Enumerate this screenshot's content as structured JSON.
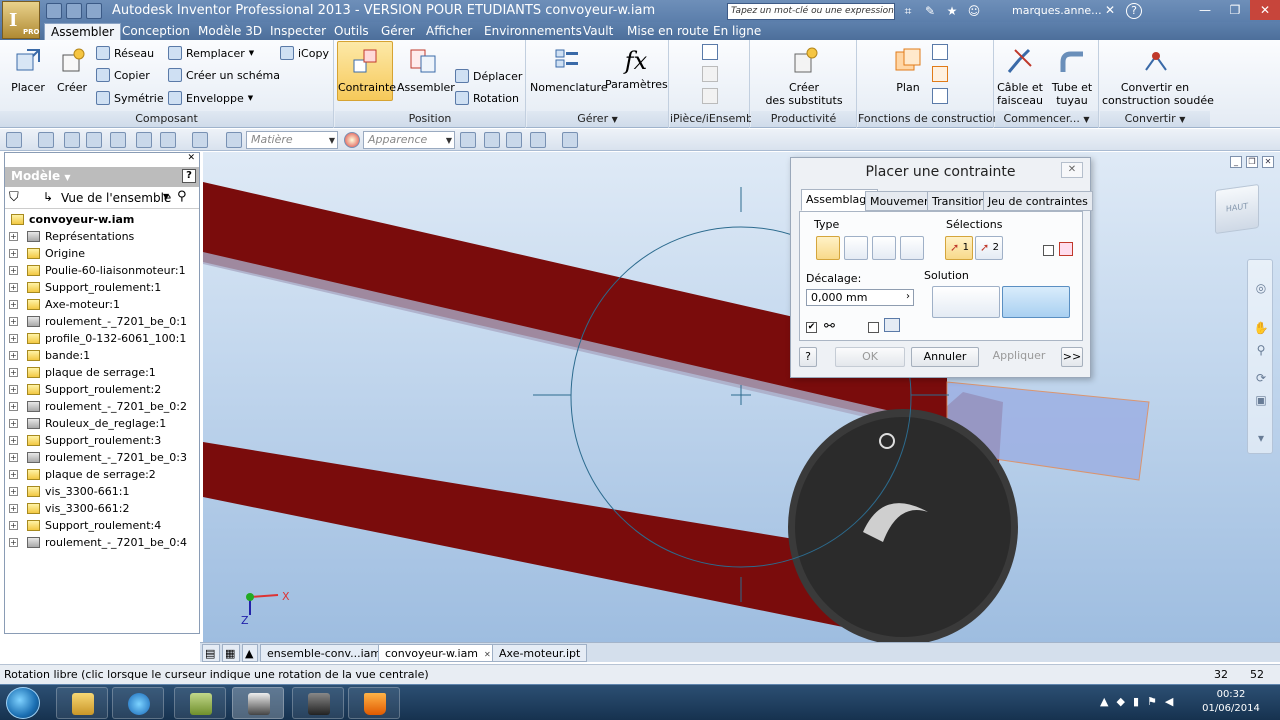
{
  "app": {
    "logo_letter": "I",
    "logo_sub": "PRO",
    "window_title": "Autodesk Inventor Professional 2013 - VERSION POUR ETUDIANTS    convoyeur-w.iam",
    "search_placeholder": "Tapez un mot-clé ou une expression",
    "user": "marques.anne...",
    "help_icon": "?"
  },
  "menu_tabs": [
    "Assembler",
    "Conception",
    "Modèle 3D",
    "Inspecter",
    "Outils",
    "Gérer",
    "Afficher",
    "Environnements",
    "Vault",
    "Mise en route",
    "En ligne"
  ],
  "ribbon": {
    "composant": {
      "title": "Composant",
      "placer": "Placer",
      "creer": "Créer",
      "reseau": "Réseau",
      "copier": "Copier",
      "symetrie": "Symétrie",
      "remplacer": "Remplacer",
      "creer_schema": "Créer un schéma",
      "enveloppe": "Enveloppe",
      "icopy": "iCopy"
    },
    "position": {
      "title": "Position",
      "contrainte": "Contrainte",
      "assembler": "Assembler",
      "deplacer": "Déplacer",
      "rotation": "Rotation"
    },
    "gerer": {
      "title": "Gérer",
      "nomenclature": "Nomenclature",
      "parametres": "Paramètres"
    },
    "ipiece": {
      "title": "iPièce/iEnsemble"
    },
    "productivite": {
      "title": "Productivité",
      "creer_substituts_1": "Créer",
      "creer_substituts_2": "des substituts"
    },
    "fonctions": {
      "title": "Fonctions de construction",
      "plan": "Plan"
    },
    "commencer": {
      "title": "Commencer...",
      "cable_1": "Câble et",
      "cable_2": "faisceau",
      "tube_1": "Tube et",
      "tube_2": "tuyau"
    },
    "convertir": {
      "title": "Convertir",
      "convert_1": "Convertir en",
      "convert_2": "construction soudée"
    }
  },
  "toolbar2": {
    "material": "Matière",
    "appearance": "Apparence"
  },
  "browser": {
    "title": "Modèle",
    "view": "Vue de l'ensemble",
    "root": "convoyeur-w.iam",
    "nodes": [
      {
        "label": "Représentations",
        "icon": "representations-icon"
      },
      {
        "label": "Origine",
        "icon": "folder-icon"
      },
      {
        "label": "Poulie-60-liaisonmoteur:1",
        "icon": "part-icon"
      },
      {
        "label": "Support_roulement:1",
        "icon": "part-icon"
      },
      {
        "label": "Axe-moteur:1",
        "icon": "part-icon"
      },
      {
        "label": "roulement_-_7201_be_0:1",
        "icon": "assembly-icon"
      },
      {
        "label": "profile_0-132-6061_100:1",
        "icon": "part-icon"
      },
      {
        "label": "bande:1",
        "icon": "part-icon"
      },
      {
        "label": "plaque de serrage:1",
        "icon": "part-icon"
      },
      {
        "label": "Support_roulement:2",
        "icon": "part-icon"
      },
      {
        "label": "roulement_-_7201_be_0:2",
        "icon": "assembly-icon"
      },
      {
        "label": "Rouleux_de_reglage:1",
        "icon": "assembly-icon"
      },
      {
        "label": "Support_roulement:3",
        "icon": "part-icon"
      },
      {
        "label": "roulement_-_7201_be_0:3",
        "icon": "assembly-icon"
      },
      {
        "label": "plaque de serrage:2",
        "icon": "part-icon"
      },
      {
        "label": "vis_3300-661:1",
        "icon": "part-icon"
      },
      {
        "label": "vis_3300-661:2",
        "icon": "part-icon"
      },
      {
        "label": "Support_roulement:4",
        "icon": "part-icon"
      },
      {
        "label": "roulement_-_7201_be_0:4",
        "icon": "assembly-icon"
      }
    ]
  },
  "viewport": {
    "viewcube_label": "HAUT",
    "axis_x": "X",
    "axis_z": "Z"
  },
  "dialog": {
    "title": "Placer une contrainte",
    "tabs": [
      "Assemblage",
      "Mouvement",
      "Transition",
      "Jeu de contraintes"
    ],
    "type_label": "Type",
    "selections_label": "Sélections",
    "sel1": "1",
    "sel2": "2",
    "offset_label": "Décalage:",
    "offset_value": "0,000 mm",
    "solution_label": "Solution",
    "ok": "OK",
    "cancel": "Annuler",
    "apply": "Appliquer",
    "more": ">>",
    "help": "?"
  },
  "doc_tabs": [
    "ensemble-conv...iam",
    "convoyeur-w.iam",
    "Axe-moteur.ipt"
  ],
  "status": {
    "text": "Rotation libre (clic lorsque le curseur indique une rotation de la vue centrale)",
    "num1": "32",
    "num2": "52"
  },
  "taskbar": {
    "time": "00:32",
    "date": "01/06/2014"
  },
  "colors": {
    "beam": "#7a0c0c",
    "accent": "#f6c95a",
    "viewport_top": "#dfeaf6",
    "viewport_bottom": "#9ebde0"
  }
}
